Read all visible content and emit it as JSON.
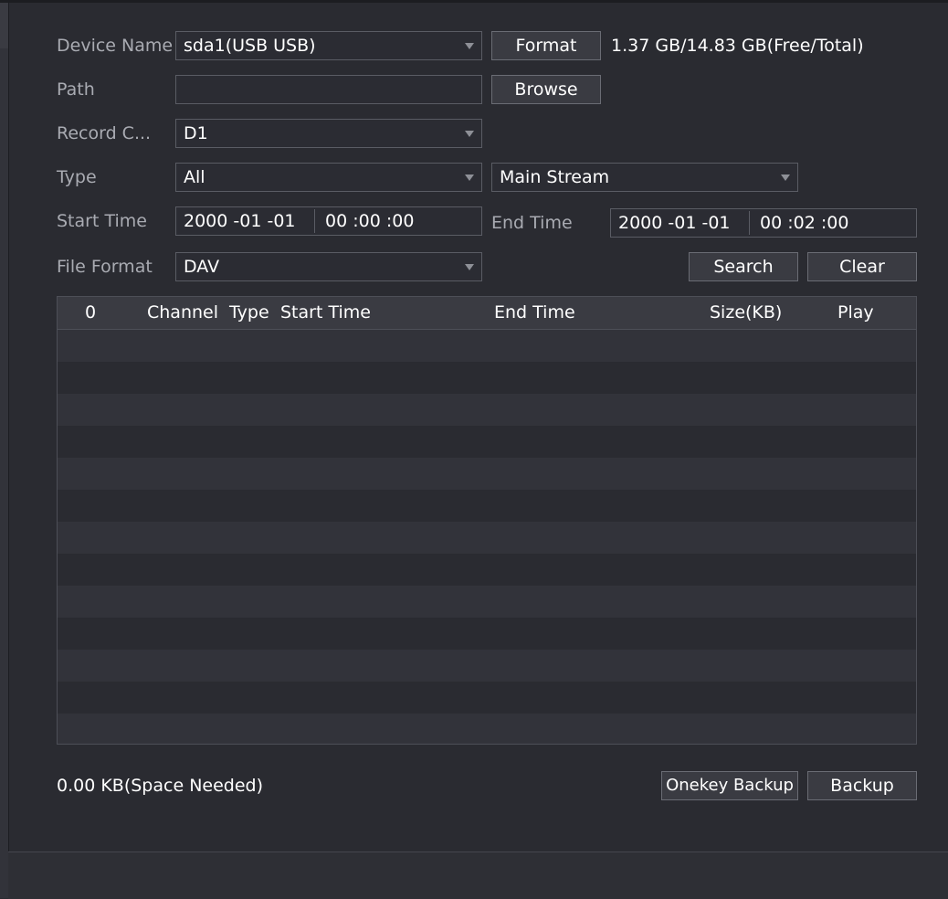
{
  "form": {
    "device_name": {
      "label": "Device Name",
      "value": "sda1(USB USB)"
    },
    "format_button": "Format",
    "capacity": "1.37 GB/14.83 GB(Free/Total)",
    "path": {
      "label": "Path",
      "value": ""
    },
    "browse_button": "Browse",
    "record_channel": {
      "label": "Record C...",
      "value": "D1"
    },
    "type": {
      "label": "Type",
      "value": "All",
      "stream": "Main Stream"
    },
    "start_time": {
      "label": "Start Time",
      "date": "2000  -01 -01",
      "time": "00 :00 :00"
    },
    "end_time": {
      "label": "End Time",
      "date": "2000  -01 -01",
      "time": "00 :02 :00"
    },
    "file_format": {
      "label": "File Format",
      "value": "DAV"
    },
    "search_button": "Search",
    "clear_button": "Clear"
  },
  "table": {
    "columns": [
      "0",
      "Channel",
      "Type",
      "Start Time",
      "End Time",
      "Size(KB)",
      "Play"
    ],
    "rows": []
  },
  "bottom": {
    "space_needed": "0.00 KB(Space Needed)",
    "onekey_backup_button": "Onekey Backup",
    "backup_button": "Backup"
  }
}
